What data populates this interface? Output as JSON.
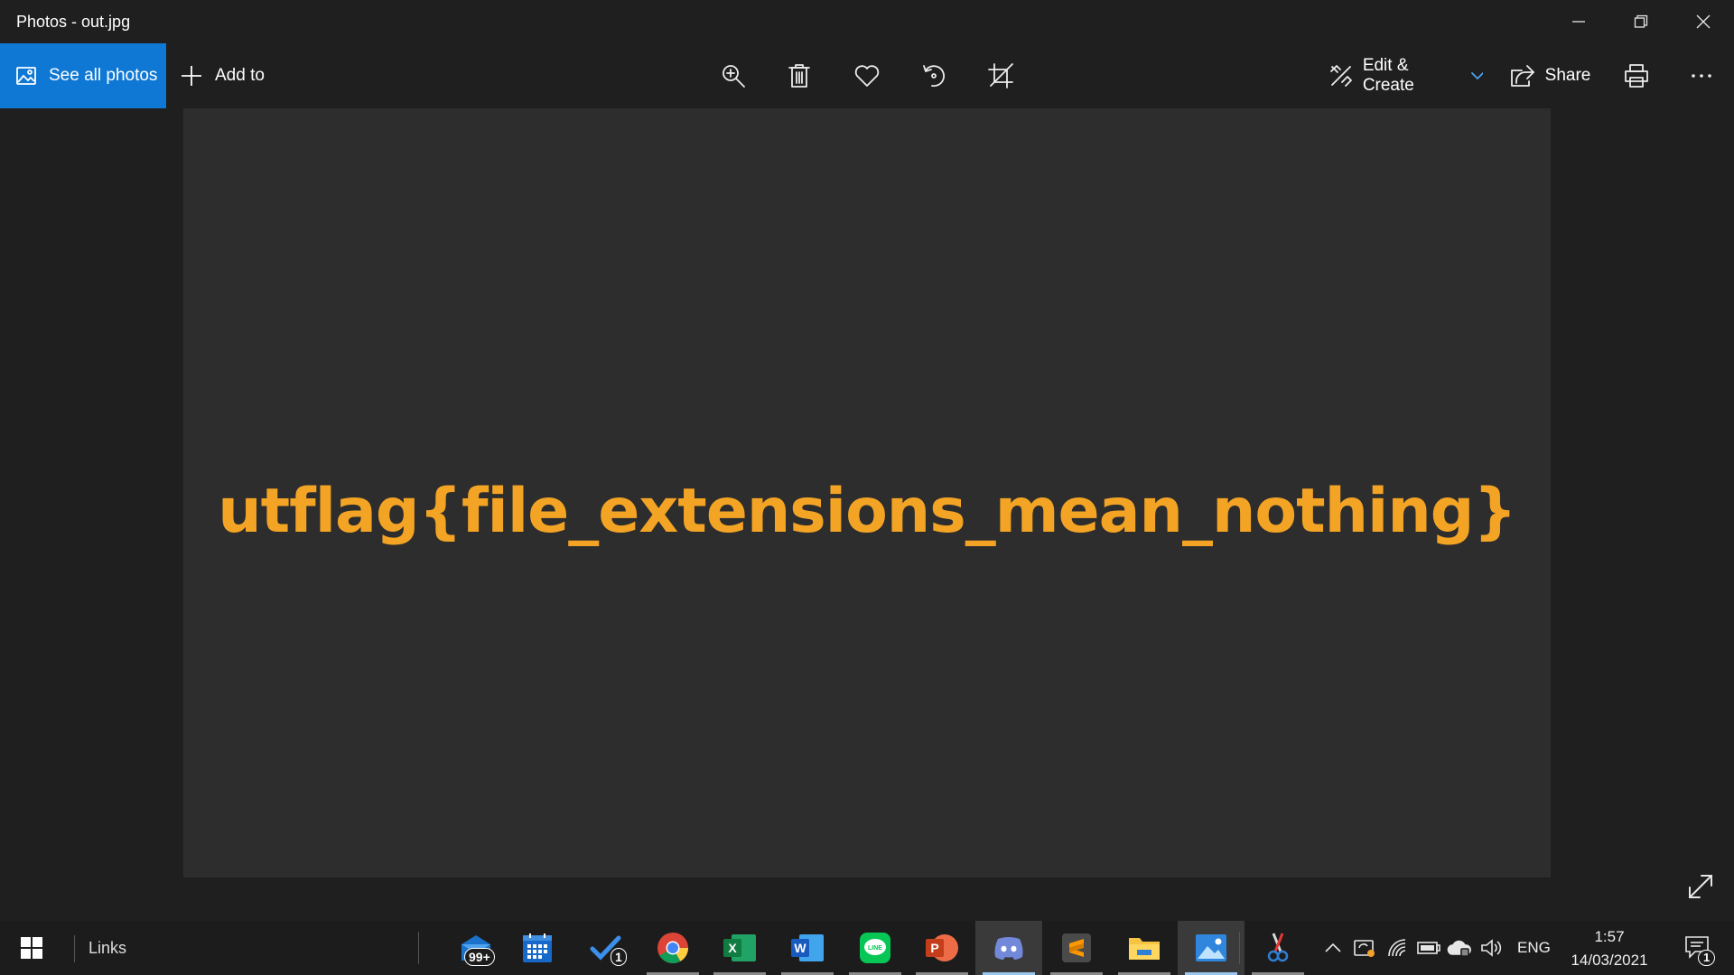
{
  "window": {
    "title": "Photos - out.jpg",
    "buttons": [
      "minimize",
      "restore",
      "close"
    ]
  },
  "toolbar": {
    "see_all_label": "See all photos",
    "add_to_label": "Add to",
    "tools": [
      "zoom-in-icon",
      "delete-icon",
      "favorite-icon",
      "rotate-icon",
      "crop-icon"
    ],
    "edit_create_label": "Edit & Create",
    "share_label": "Share",
    "more_icon": "ellipsis-icon",
    "accent_color": "#0f78d4"
  },
  "photo": {
    "text": "utflag{file_extensions_mean_nothing}",
    "text_color": "#f4a425",
    "background": "#2d2d2d"
  },
  "taskbar": {
    "links_label": "Links",
    "apps": [
      {
        "name": "mail",
        "badge": "99+"
      },
      {
        "name": "calendar"
      },
      {
        "name": "todo",
        "badge": "1"
      },
      {
        "name": "chrome"
      },
      {
        "name": "excel"
      },
      {
        "name": "word"
      },
      {
        "name": "line"
      },
      {
        "name": "powerpoint"
      },
      {
        "name": "discord"
      },
      {
        "name": "sublime-text"
      },
      {
        "name": "file-explorer"
      },
      {
        "name": "photos"
      },
      {
        "name": "snipping-tool"
      }
    ],
    "language": "ENG",
    "time": "1:57",
    "date": "14/03/2021",
    "notification_count": "1"
  }
}
